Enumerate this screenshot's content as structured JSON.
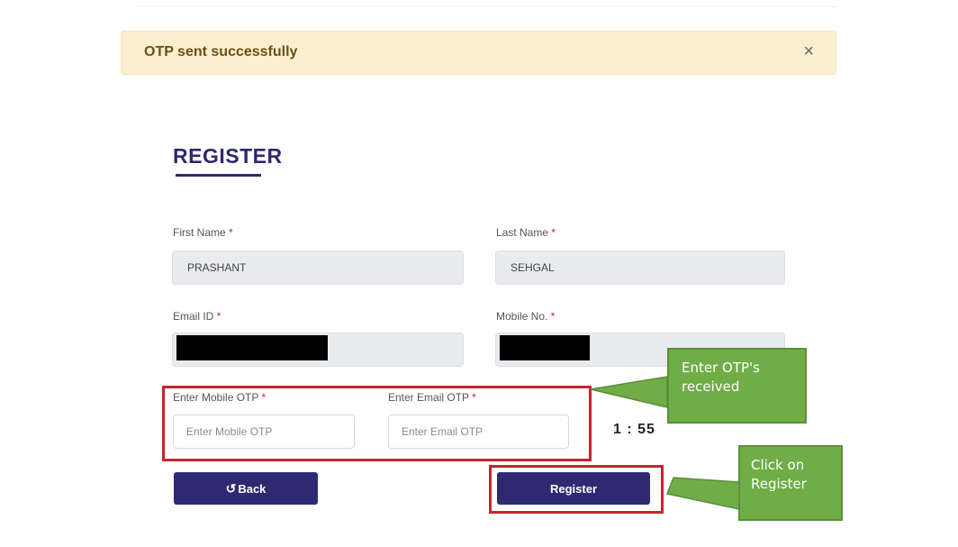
{
  "alert": {
    "message": "OTP sent successfully",
    "close_glyph": "×"
  },
  "form": {
    "title": "REGISTER",
    "required_mark": "*",
    "first_name": {
      "label": "First Name",
      "value": "PRASHANT"
    },
    "last_name": {
      "label": "Last Name",
      "value": "SEHGAL"
    },
    "email": {
      "label": "Email ID",
      "value": ""
    },
    "mobile": {
      "label": "Mobile No.",
      "value": ""
    },
    "mobile_otp": {
      "label": "Enter Mobile OTP",
      "placeholder": "Enter Mobile OTP",
      "value": ""
    },
    "email_otp": {
      "label": "Enter Email OTP",
      "placeholder": "Enter Email OTP",
      "value": ""
    },
    "timer": "1 : 55",
    "back_label": "Back",
    "back_icon": "undo-arrow-icon",
    "register_label": "Register"
  },
  "callouts": {
    "otp": "Enter OTP's received",
    "register": "Click on Register"
  },
  "colors": {
    "alert_bg": "#fbefcf",
    "alert_text": "#6b5013",
    "primary": "#2e2a72",
    "title": "#2b2a6e",
    "required": "#cc2222",
    "highlight": "#c1272d",
    "callout": "#70ad47",
    "readonly_field": "#e9ebee"
  }
}
